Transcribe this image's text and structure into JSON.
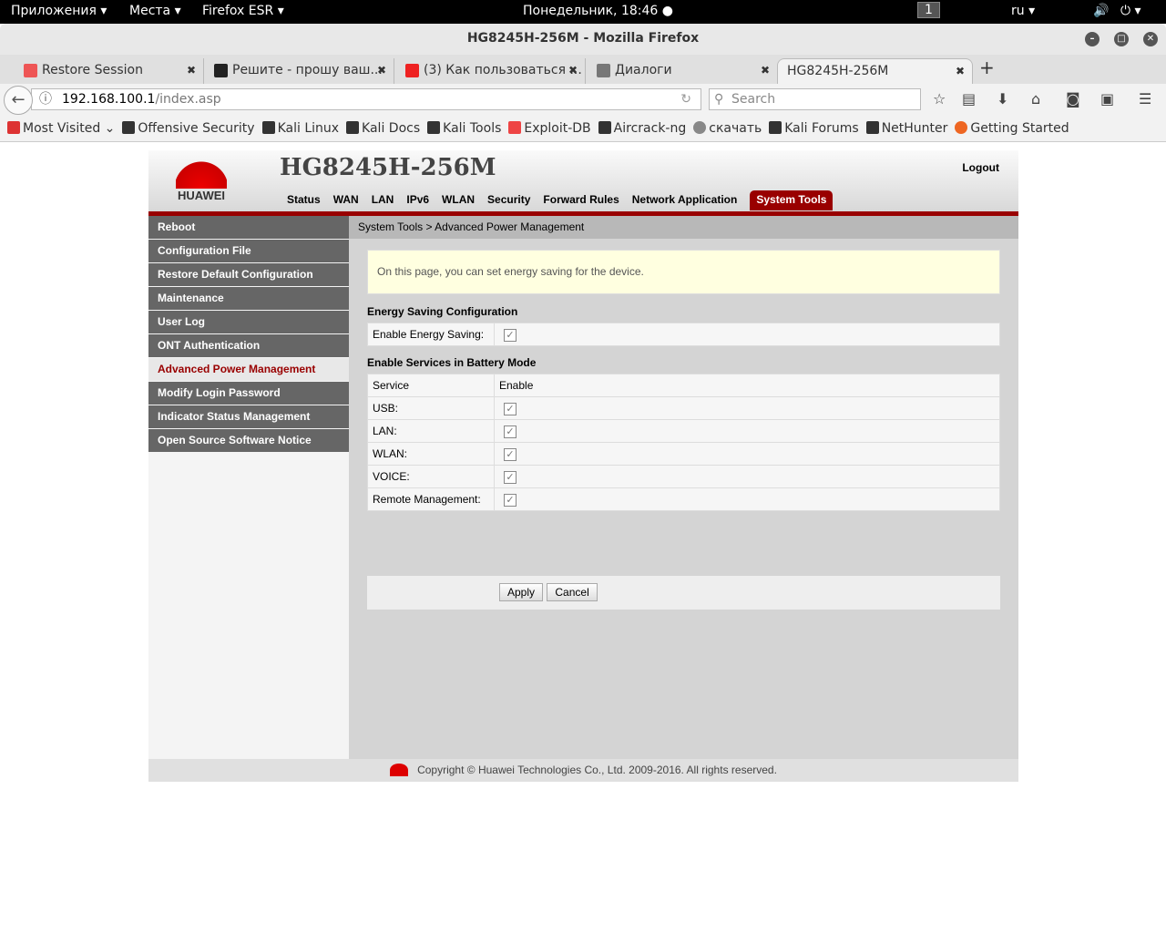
{
  "system": {
    "apps": "Приложения ▾",
    "places": "Места ▾",
    "firefox": "Firefox ESR ▾",
    "clock": "Понедельник, 18:46 ●",
    "workspace": "1",
    "lang": "ru ▾"
  },
  "window": {
    "title": "HG8245H-256M - Mozilla Firefox"
  },
  "tabs": [
    {
      "label": "Restore Session"
    },
    {
      "label": "Решите - прошу ваш..."
    },
    {
      "label": "(3) Как пользоваться ..."
    },
    {
      "label": "Диалоги"
    },
    {
      "label": "HG8245H-256M"
    }
  ],
  "nav": {
    "url_host": "192.168.100.1",
    "url_path": "/index.asp",
    "search_placeholder": "Search"
  },
  "bookmarks": [
    "Most Visited ⌄",
    "Offensive Security",
    "Kali Linux",
    "Kali Docs",
    "Kali Tools",
    "Exploit-DB",
    "Aircrack-ng",
    "скачать",
    "Kali Forums",
    "NetHunter",
    "Getting Started"
  ],
  "router": {
    "brand": "HUAWEI",
    "title": "HG8245H-256M",
    "logout": "Logout",
    "menu": [
      "Status",
      "WAN",
      "LAN",
      "IPv6",
      "WLAN",
      "Security",
      "Forward Rules",
      "Network Application",
      "System Tools"
    ],
    "sidebar": [
      "Reboot",
      "Configuration File",
      "Restore Default Configuration",
      "Maintenance",
      "User Log",
      "ONT Authentication",
      "Advanced Power Management",
      "Modify Login Password",
      "Indicator Status Management",
      "Open Source Software Notice"
    ],
    "breadcrumb": "System Tools > Advanced Power Management",
    "info": "On this page, you can set energy saving for the device.",
    "energy_title": "Energy Saving Configuration",
    "energy_label": "Enable Energy Saving:",
    "battery_title": "Enable Services in Battery Mode",
    "col_service": "Service",
    "col_enable": "Enable",
    "services": [
      "USB:",
      "LAN:",
      "WLAN:",
      "VOICE:",
      "Remote Management:"
    ],
    "apply": "Apply",
    "cancel": "Cancel",
    "copyright": "Copyright © Huawei Technologies Co., Ltd. 2009-2016. All rights reserved."
  }
}
